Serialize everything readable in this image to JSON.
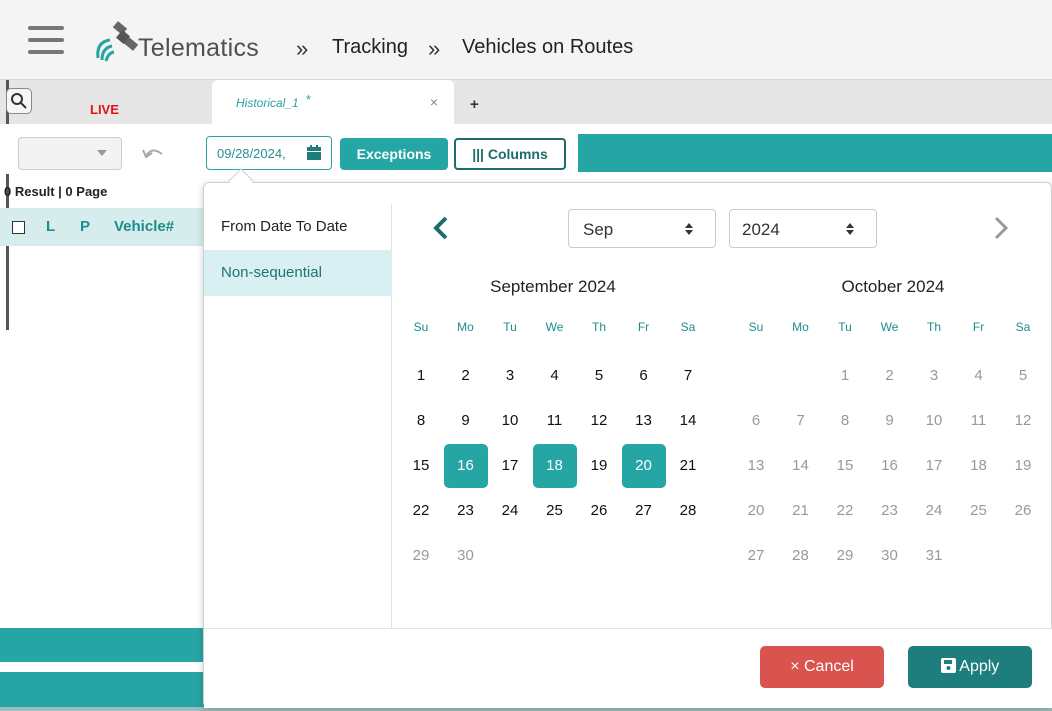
{
  "header": {
    "brand": "Telematics",
    "crumb_sep": "»",
    "crumbs": [
      "Tracking",
      "Vehicles on Routes"
    ]
  },
  "tabs": {
    "live": "LIVE",
    "historical": "Historical_1",
    "historical_modified": "*",
    "close": "×",
    "add": "+"
  },
  "toolbar": {
    "date": "09/28/2024,",
    "exceptions": "Exceptions",
    "columns": "Columns",
    "columns_icon_glyph": "|||"
  },
  "grid": {
    "result_text": "0 Result | 0 Page",
    "columns": [
      "L",
      "P",
      "Vehicle#"
    ]
  },
  "picker": {
    "ranges": [
      "From Date To Date",
      "Non-sequential"
    ],
    "active_range": "Non-sequential",
    "month_select": "Sep",
    "year_select": "2024",
    "months": [
      {
        "title": "September 2024",
        "first_weekday": 0,
        "days": 30
      },
      {
        "title": "October 2024",
        "first_weekday": 2,
        "days": 31
      }
    ],
    "weekdays": [
      "Su",
      "Mo",
      "Tu",
      "We",
      "Th",
      "Fr",
      "Sa"
    ],
    "selected_days": [
      16,
      18,
      20
    ],
    "cancel": "Cancel",
    "cancel_icon": "×",
    "apply": "Apply"
  },
  "colors": {
    "teal": "#26a5a5",
    "dark_teal": "#1e7d7d",
    "cancel_red": "#d9534f",
    "live_red": "#e3131b"
  },
  "icons": {
    "menu": "hamburger-icon",
    "search": "search-icon",
    "undo": "undo-icon",
    "calendar": "calendar-icon",
    "prev": "chevron-left-icon",
    "next": "chevron-right-icon",
    "save": "save-icon"
  }
}
